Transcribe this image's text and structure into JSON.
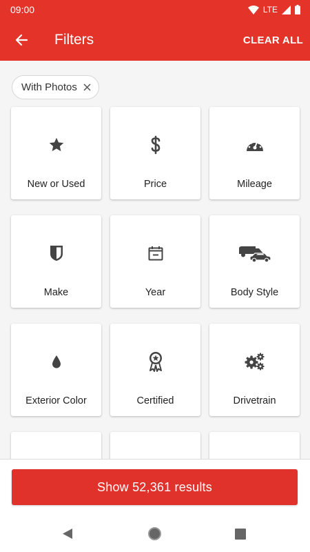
{
  "status_bar": {
    "time": "09:00",
    "network": "LTE"
  },
  "app_bar": {
    "title": "Filters",
    "clear_label": "CLEAR ALL"
  },
  "chips": [
    {
      "label": "With Photos"
    }
  ],
  "filters": [
    {
      "label": "New or Used",
      "icon": "star-icon"
    },
    {
      "label": "Price",
      "icon": "dollar-icon"
    },
    {
      "label": "Mileage",
      "icon": "speedometer-icon"
    },
    {
      "label": "Make",
      "icon": "shield-icon"
    },
    {
      "label": "Year",
      "icon": "calendar-icon"
    },
    {
      "label": "Body Style",
      "icon": "vehicles-icon"
    },
    {
      "label": "Exterior Color",
      "icon": "drop-icon"
    },
    {
      "label": "Certified",
      "icon": "award-icon"
    },
    {
      "label": "Drivetrain",
      "icon": "gears-icon"
    },
    {
      "label": "",
      "icon": ""
    },
    {
      "label": "",
      "icon": ""
    },
    {
      "label": "",
      "icon": ""
    }
  ],
  "results_button": {
    "label": "Show 52,361 results"
  },
  "colors": {
    "brand_red": "#e4342a",
    "icon_gray": "#444444"
  }
}
